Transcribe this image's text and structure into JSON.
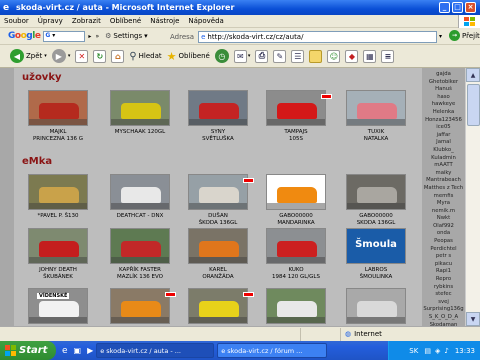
{
  "window": {
    "title": "skoda-virt.cz / auta - Microsoft Internet Explorer"
  },
  "menu": [
    "Soubor",
    "Úpravy",
    "Zobrazit",
    "Oblíbené",
    "Nástroje",
    "Nápověda"
  ],
  "google_bar": {
    "logo": "Google",
    "settings_label": "Settings"
  },
  "address": {
    "label": "Adresa",
    "url": "http://skoda-virt.cz/cz/auta/",
    "go_label": "Přejít"
  },
  "toolbar": {
    "back_label": "Zpět",
    "search_label": "Hledat",
    "favorites_label": "Oblíbené"
  },
  "sections": [
    {
      "title": "užovky",
      "cards": [
        {
          "line1": "MAJKL",
          "line2": "PRINCEZNA 136 G",
          "color": "#b06a4a",
          "car": "#b52a1e",
          "badge": false
        },
        {
          "line1": "MYSCHAAK 120GL",
          "line2": "",
          "color": "#7a8a6a",
          "car": "#d6c414",
          "badge": false
        },
        {
          "line1": "SYNY",
          "line2": "SVĚTLUŠKA",
          "color": "#707a86",
          "car": "#c42323",
          "badge": false
        },
        {
          "line1": "TAMPAJS",
          "line2": "105S",
          "color": "#8c8c8c",
          "car": "#d41818",
          "badge": true
        },
        {
          "line1": "TUXIK",
          "line2": "NATALKA",
          "color": "#a5b0b8",
          "car": "#e07a86",
          "badge": false
        }
      ]
    },
    {
      "title": "eMka",
      "cards": [
        {
          "line1": "*PAVEL P. Š130",
          "line2": "",
          "color": "#7c7a50",
          "car": "#c9a24a",
          "badge": false
        },
        {
          "line1": "DEATHCAT - DNX",
          "line2": "",
          "color": "#8a8f96",
          "car": "#e8e8e8",
          "badge": false
        },
        {
          "line1": "DUŠAN",
          "line2": "ŠKODA 136GL",
          "color": "#96a0a6",
          "car": "#d9d5cc",
          "badge": true
        },
        {
          "line1": "GABO00000",
          "line2": "MANDARINKA",
          "color": "#ffffff",
          "car": "#f08a10",
          "badge": false
        },
        {
          "line1": "GABO00000",
          "line2": "SKODA 136GL",
          "color": "#6c6a64",
          "car": "#a9a6a0",
          "badge": false
        },
        {
          "line1": "JOHNY DEATH",
          "line2": "ŠKUBÁNEK",
          "color": "#7e8a70",
          "car": "#c41e1e",
          "badge": false
        },
        {
          "line1": "KAPŘÍK FASTER",
          "line2": "MAZLÍK 136 EVO",
          "color": "#5e7a52",
          "car": "#c22828",
          "badge": false
        },
        {
          "line1": "KAREL",
          "line2": "ORANŽÁDA",
          "color": "#7a7366",
          "car": "#e0761c",
          "badge": false
        },
        {
          "line1": "KUKO",
          "line2": "1984 120 GL/GLS",
          "color": "#8c8f92",
          "car": "#cc2020",
          "badge": false
        },
        {
          "line1": "LABROS",
          "line2": "ŠMOULINKA",
          "color": "#1a5ca8",
          "car": "#ffffff",
          "badge": false
        },
        {
          "line1": "",
          "line2": "",
          "color": "#8e8e8e",
          "car": "#f2f2f2",
          "badge": false
        },
        {
          "line1": "",
          "line2": "",
          "color": "#8a7a66",
          "car": "#e88a18",
          "badge": true
        },
        {
          "line1": "",
          "line2": "",
          "color": "#7c7c6a",
          "car": "#e8d21a",
          "badge": true
        },
        {
          "line1": "",
          "line2": "",
          "color": "#6f8a5e",
          "car": "#e8e8e8",
          "badge": false
        },
        {
          "line1": "",
          "line2": "",
          "color": "#a9a9a9",
          "car": "#d9d9d9",
          "badge": false
        }
      ]
    }
  ],
  "thumb_texts": {
    "smoula": "Šmoula",
    "plate": "VÍDENSKÉ"
  },
  "sidebar_users": [
    "gajda",
    "Ghetobiker",
    "Hanuš",
    "haso",
    "hawkeye",
    "Helenka",
    "Honza123456",
    "ice05",
    "jaffar",
    "Jamal",
    "Klubko_",
    "Kuladmin",
    "mAATT",
    "maiky",
    "Mantrabeach",
    "Matthes z Tech",
    "memfis",
    "Myra",
    "nemik.m",
    "Nwkt",
    "Olaf992",
    "onda",
    "Peopas",
    "Perdichtel",
    "petr s",
    "pikacu",
    "Rapi1",
    "Repro",
    "rybkins",
    "stefec",
    "svej",
    "Surprising136g",
    "Š_K_O_D_A",
    "Škodaman"
  ],
  "status": {
    "zone": "Internet"
  },
  "taskbar": {
    "start_label": "Start",
    "tasks": [
      "skoda-virt.cz / auta - ...",
      "skoda-virt.cz / fórum ..."
    ],
    "lang": "SK",
    "clock": "13:33"
  }
}
